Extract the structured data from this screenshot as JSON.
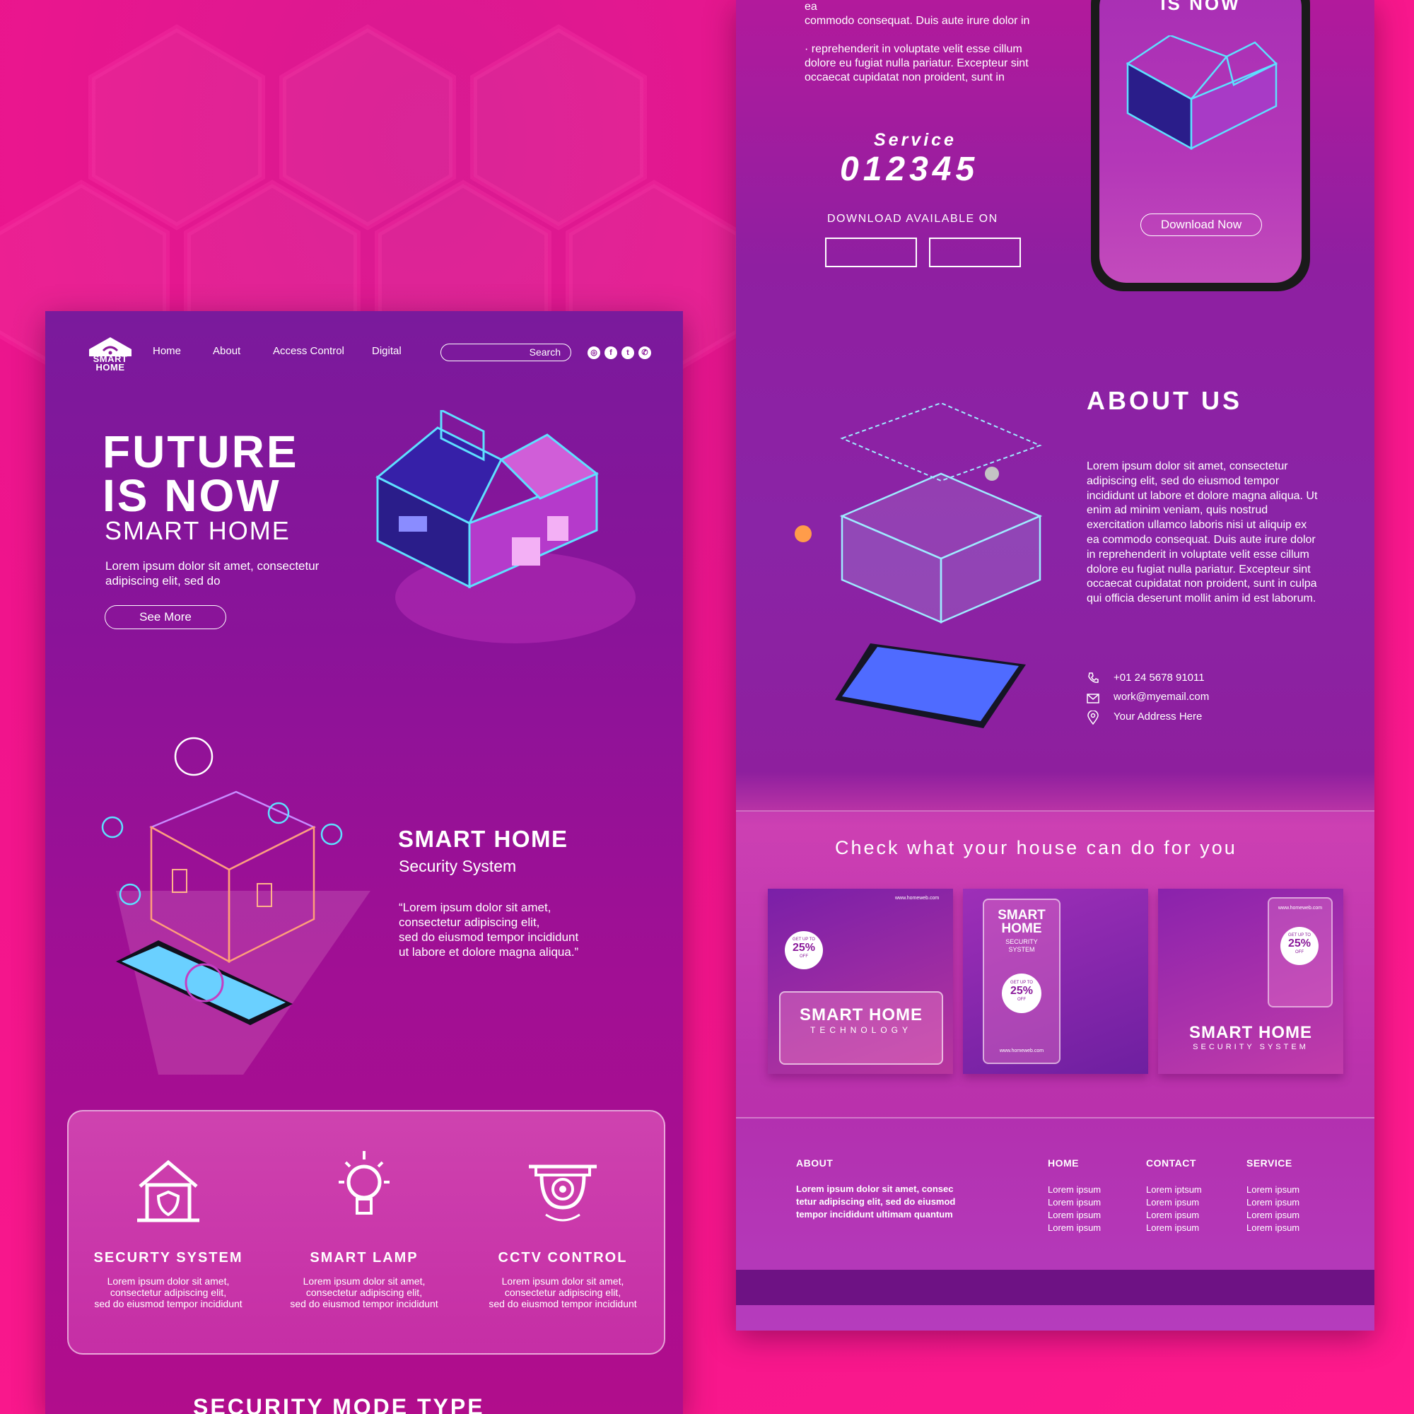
{
  "brand": {
    "logo_line1": "SMART",
    "logo_line2": "HOME"
  },
  "nav": [
    "Home",
    "About",
    "Access Control",
    "Digital"
  ],
  "search": {
    "label": "Search"
  },
  "hero": {
    "title_line1": "FUTURE",
    "title_line2": "IS NOW",
    "subtitle": "SMART HOME",
    "description": "Lorem ipsum dolor sit amet, consectetur adipiscing elit, sed do",
    "button": "See More"
  },
  "security": {
    "title": "SMART HOME",
    "subtitle": "Security System",
    "quote_lines": [
      "“Lorem ipsum dolor sit amet,",
      "consectetur adipiscing elit,",
      "sed do eiusmod tempor incididunt",
      "ut labore et dolore magna aliqua.”"
    ]
  },
  "features": [
    {
      "title": "SECURTY SYSTEM",
      "desc_lines": [
        "Lorem ipsum dolor sit amet,",
        "consectetur adipiscing elit,",
        "sed do eiusmod tempor incididunt"
      ],
      "icon": "house-shield-icon"
    },
    {
      "title": "SMART LAMP",
      "desc_lines": [
        "Lorem ipsum dolor sit amet,",
        "consectetur adipiscing elit,",
        "sed do eiusmod tempor incididunt"
      ],
      "icon": "light-bulb-icon"
    },
    {
      "title": "CCTV CONTROL",
      "desc_lines": [
        "Lorem ipsum dolor sit amet,",
        "consectetur adipiscing elit,",
        "sed do eiusmod tempor incididunt"
      ],
      "icon": "cctv-camera-icon"
    }
  ],
  "mode_title": "SECURITY MODE TYPE",
  "right_top": {
    "text_lines": [
      "ea",
      "commodo consequat. Duis aute irure dolor in",
      "",
      "· reprehenderit in voluptate velit esse cillum",
      "dolore eu fugiat nulla pariatur. Excepteur sint",
      "occaecat cupidatat non proident, sunt in"
    ],
    "service_label": "Service",
    "service_number": "012345",
    "download_label": "DOWNLOAD AVAILABLE ON",
    "phone_heading": "IS NOW",
    "phone_button": "Download Now"
  },
  "about": {
    "title": "ABOUT US",
    "description": "Lorem ipsum dolor sit amet, consectetur adipiscing elit, sed do eiusmod tempor incididunt ut labore et dolore magna aliqua. Ut enim ad minim veniam, quis nostrud exercitation ullamco laboris nisi ut aliquip ex ea commodo consequat. Duis aute irure dolor in reprehenderit in voluptate velit esse cillum dolore eu fugiat nulla pariatur. Excepteur sint occaecat cupidatat non proident, sunt in culpa qui officia deserunt mollit anim id est laborum.",
    "phone": "+01 24 5678 91011",
    "email": "work@myemail.com",
    "address": "Your Address Here"
  },
  "check_title": "Check what your house can do for you",
  "cards": [
    {
      "title": "SMART HOME",
      "subtitle": "TECHNOLOGY",
      "offer_top": "GET UP TO",
      "offer_value": "25%",
      "offer_bottom": "OFF",
      "url": "www.homeweb.com"
    },
    {
      "title_line1": "SMART",
      "title_line2": "HOME",
      "subtitle_line1": "SECURITY",
      "subtitle_line2": "SYSTEM",
      "offer_top": "GET UP TO",
      "offer_value": "25%",
      "offer_bottom": "OFF",
      "url": "www.homeweb.com"
    },
    {
      "title": "SMART HOME",
      "subtitle": "SECURITY SYSTEM",
      "offer_top": "GET UP TO",
      "offer_value": "25%",
      "offer_bottom": "OFF",
      "url": "www.homeweb.com"
    }
  ],
  "footer": {
    "about_head": "ABOUT",
    "about_text": "Lorem ipsum dolor sit amet, consec tetur adipiscing elit, sed do eiusmod tempor incididunt ultimam quantum",
    "columns": [
      {
        "head": "HOME",
        "items": [
          "Lorem ipsum",
          "Lorem ipsum",
          "Lorem ipsum",
          "Lorem ipsum"
        ]
      },
      {
        "head": "CONTACT",
        "items": [
          "Lorem iptsum",
          "Lorem ipsum",
          "Lorem ipsum",
          "Lorem ipsum"
        ]
      },
      {
        "head": "SERVICE",
        "items": [
          "Lorem ipsum",
          "Lorem ipsum",
          "Lorem ipsum",
          "Lorem ipsum"
        ]
      }
    ]
  },
  "colors": {
    "background": "#f0148c",
    "page_purple": "#8b1399",
    "neon_cyan": "#5ee0ff",
    "footer_band": "#6e1284"
  }
}
